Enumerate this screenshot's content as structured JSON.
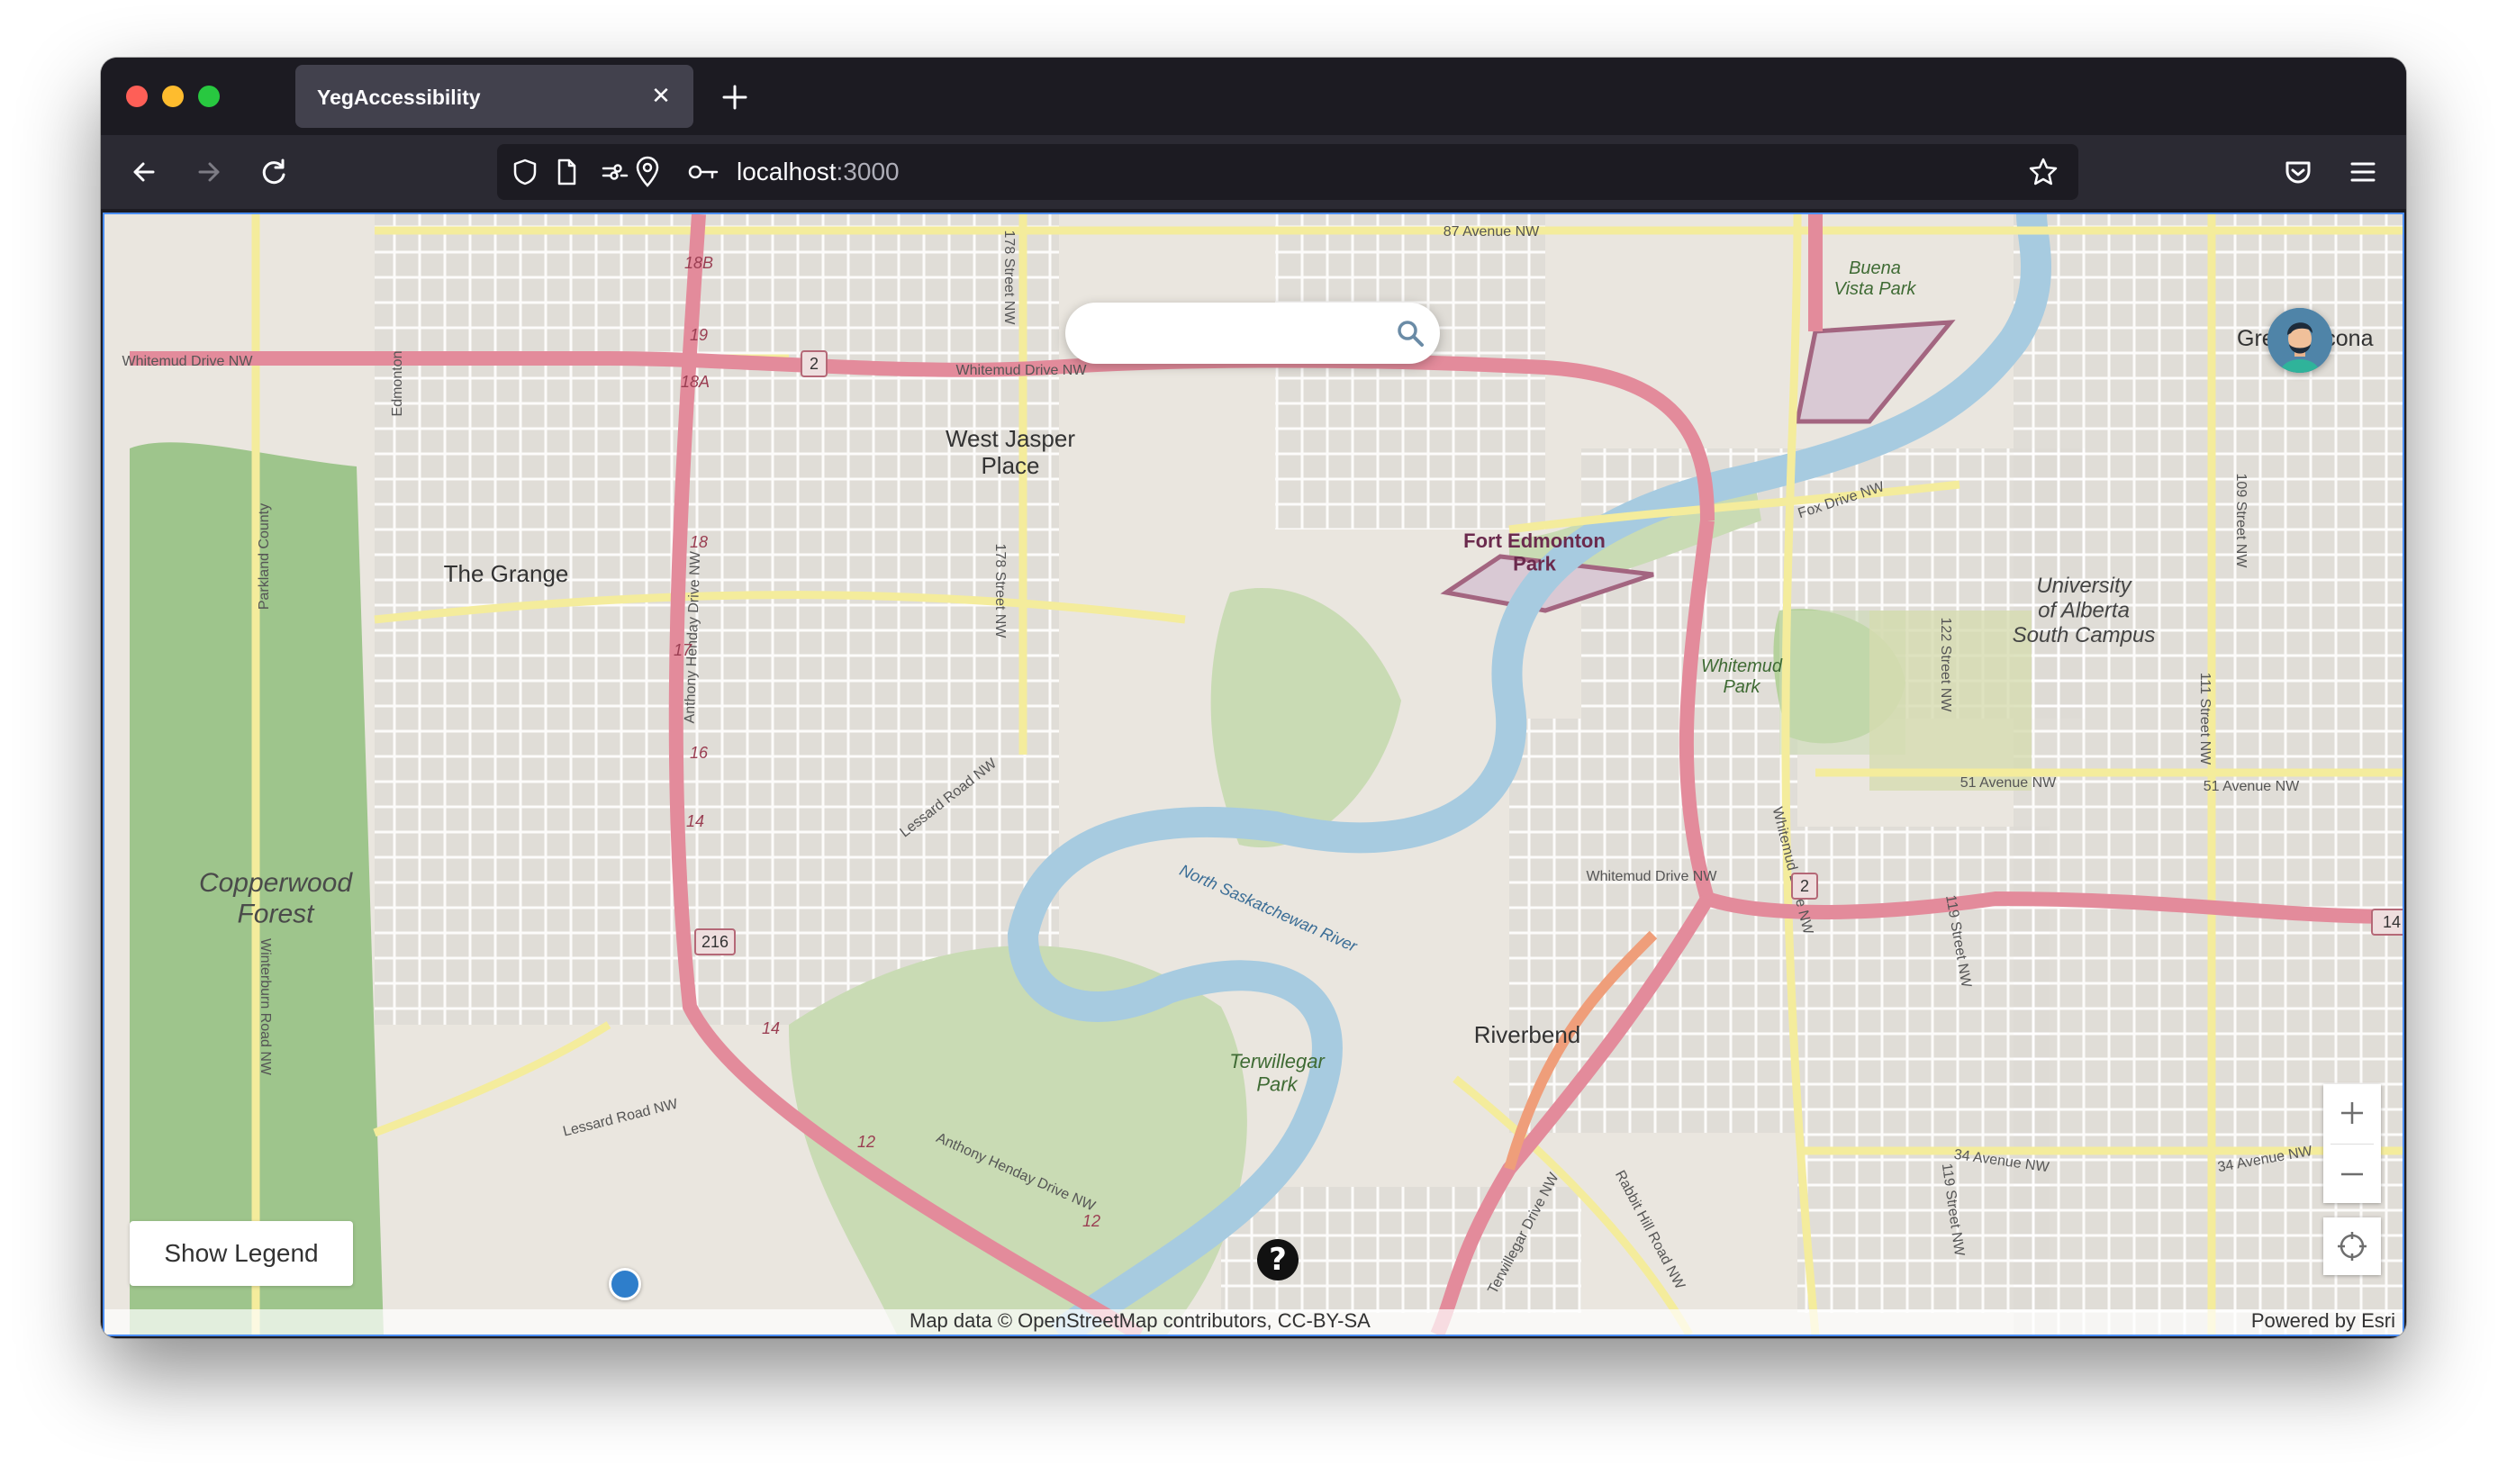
{
  "browser": {
    "tab_title": "YegAccessibility",
    "url_host": "localhost",
    "url_port": ":3000"
  },
  "search": {
    "placeholder": "",
    "value": ""
  },
  "avatar_label": "Grea   athcona",
  "controls": {
    "legend_label": "Show Legend",
    "help_label": "?"
  },
  "attribution": {
    "text": "Map data © OpenStreetMap contributors, CC-BY-SA",
    "powered": "Powered by Esri"
  },
  "map": {
    "places": [
      {
        "name": "West Jasper Place",
        "lines": [
          "West Jasper",
          "Place"
        ]
      },
      {
        "name": "The Grange",
        "lines": [
          "The Grange"
        ]
      },
      {
        "name": "Copperwood Forest",
        "lines": [
          "Copperwood",
          "Forest"
        ]
      },
      {
        "name": "Fort Edmonton Park",
        "lines": [
          "Fort Edmonton",
          "Park"
        ]
      },
      {
        "name": "University of Alberta South Campus",
        "lines": [
          "University",
          "of Alberta",
          "South Campus"
        ]
      },
      {
        "name": "Whitemud Park",
        "lines": [
          "Whitemud",
          "Park"
        ]
      },
      {
        "name": "Riverbend",
        "lines": [
          "Riverbend"
        ]
      },
      {
        "name": "Terwillegar Park",
        "lines": [
          "Terwillegar",
          "Park"
        ]
      },
      {
        "name": "Buena Vista Park",
        "lines": [
          "Buena",
          "Vista Park"
        ]
      }
    ],
    "roads": [
      "87 Avenue NW",
      "Whitemud Drive NW",
      "Whitemud Drive NW",
      "Fox Drive NW",
      "51 Avenue NW",
      "51 Avenue NW",
      "34 Avenue NW",
      "34 Avenue NW",
      "Lessard Road NW",
      "Lessard Road NW",
      "Anthony Henday Drive NW",
      "Anthony Henday Drive NW",
      "Whitemud Drive NW",
      "North Saskatchewan River",
      "Terwillegar Drive NW",
      "Rabbit Hill Road NW",
      "122 Street NW",
      "119 Street NW",
      "119 Street NW",
      "111 Street NW",
      "109 Street NW",
      "178 Street NW",
      "178 Street NW",
      "Winterburn Road NW",
      "Parkland County",
      "Edmonton",
      "Whitemud Drive NW"
    ],
    "shields": [
      "2",
      "2",
      "216",
      "14"
    ],
    "exits": [
      "18B",
      "19",
      "18A",
      "18",
      "17",
      "16",
      "14",
      "12",
      "12",
      "14"
    ]
  },
  "colors": {
    "map_land": "#eae6df",
    "urban": "#dedbd5",
    "park": "#c9dbb4",
    "forest": "#9ec58c",
    "river": "#a7cbe0",
    "highway": "#e38b9b",
    "arterial": "#f4ec9c",
    "accent_border": "#4b8ef5"
  }
}
